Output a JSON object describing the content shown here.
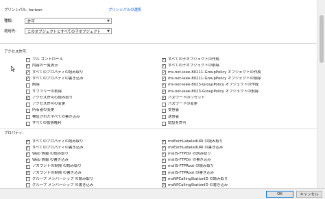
{
  "principal": {
    "label": "プリンシパル: horizon",
    "select_link": "プリンシパルの選択"
  },
  "type_field": {
    "label": "種類:",
    "value": "許可"
  },
  "applies_to": {
    "label": "適用先:",
    "value": "このオブジェクトとすべての子オブジェクト"
  },
  "access_section": {
    "header": "アクセス許可:",
    "left": [
      {
        "label": "フル コントロール",
        "checked": false
      },
      {
        "label": "内容の一覧表示",
        "checked": true
      },
      {
        "label": "すべてのプロパティの読み取り",
        "checked": true
      },
      {
        "label": "すべてのプロパティの書き込み",
        "checked": true
      },
      {
        "label": "削除",
        "checked": false
      },
      {
        "label": "サブツリーの削除",
        "checked": false
      },
      {
        "label": "アクセス許可の読み取り",
        "checked": true
      },
      {
        "label": "アクセス許可の変更",
        "checked": false
      },
      {
        "label": "所有者の変更",
        "checked": false
      },
      {
        "label": "検証されたすべての書き込み",
        "checked": false
      },
      {
        "label": "すべての拡張権利",
        "checked": false
      }
    ],
    "right": [
      {
        "label": "すべての子オブジェクトの作成",
        "checked": true
      },
      {
        "label": "すべての子オブジェクトの削除",
        "checked": true
      },
      {
        "label": "ms-net-ieee-80211-GroupPolicy オブジェクトの作成",
        "checked": true
      },
      {
        "label": "ms-net-ieee-80211-GroupPolicy オブジェクトの削除",
        "checked": true
      },
      {
        "label": "ms-net-ieee-8023-GroupPolicy オブジェクトの作成",
        "checked": true
      },
      {
        "label": "ms-net-ieee-8023-GroupPolicy オブジェクトの削除",
        "checked": true
      },
      {
        "label": "パスワードのリセット",
        "checked": true
      },
      {
        "label": "パスワードの変更",
        "checked": false
      },
      {
        "label": "受信者",
        "checked": false
      },
      {
        "label": "送信者",
        "checked": false
      },
      {
        "label": "認証を許可",
        "checked": false
      }
    ]
  },
  "properties_section": {
    "header": "プロパティ:",
    "left": [
      {
        "label": "すべてのプロパティの読み取り",
        "checked": true
      },
      {
        "label": "すべてのプロパティの書き込み",
        "checked": true
      },
      {
        "label": "Web 情報 の読み取り",
        "checked": true
      },
      {
        "label": "Web 情報 の書き込み",
        "checked": true
      },
      {
        "label": "アカウントの制限 の読み取り",
        "checked": true
      },
      {
        "label": "アカウントの制限 の書き込み",
        "checked": true
      },
      {
        "label": "グループ メンバーシップ の読み取り",
        "checked": false
      },
      {
        "label": "グループ メンバーシップ の書き込み",
        "checked": false
      }
    ],
    "right": [
      {
        "label": "msExchLabeledURI の読み取り",
        "checked": true
      },
      {
        "label": "msExchLabeledURI の書き込み",
        "checked": true
      },
      {
        "label": "msIIS-FTPDir の読み取り",
        "checked": true
      },
      {
        "label": "msIIS-FTPDir の書き込み",
        "checked": true
      },
      {
        "label": "msIIS-FTPRoot の読み取り",
        "checked": true
      },
      {
        "label": "msIIS-FTPRoot の書き込み",
        "checked": true
      },
      {
        "label": "msNPCallingStationID の読み取り",
        "checked": true
      },
      {
        "label": "msNPCallingStationID の書き込み",
        "checked": true
      }
    ]
  },
  "footer": {
    "ok_label": "OK",
    "cancel_label": "キャンセル"
  }
}
